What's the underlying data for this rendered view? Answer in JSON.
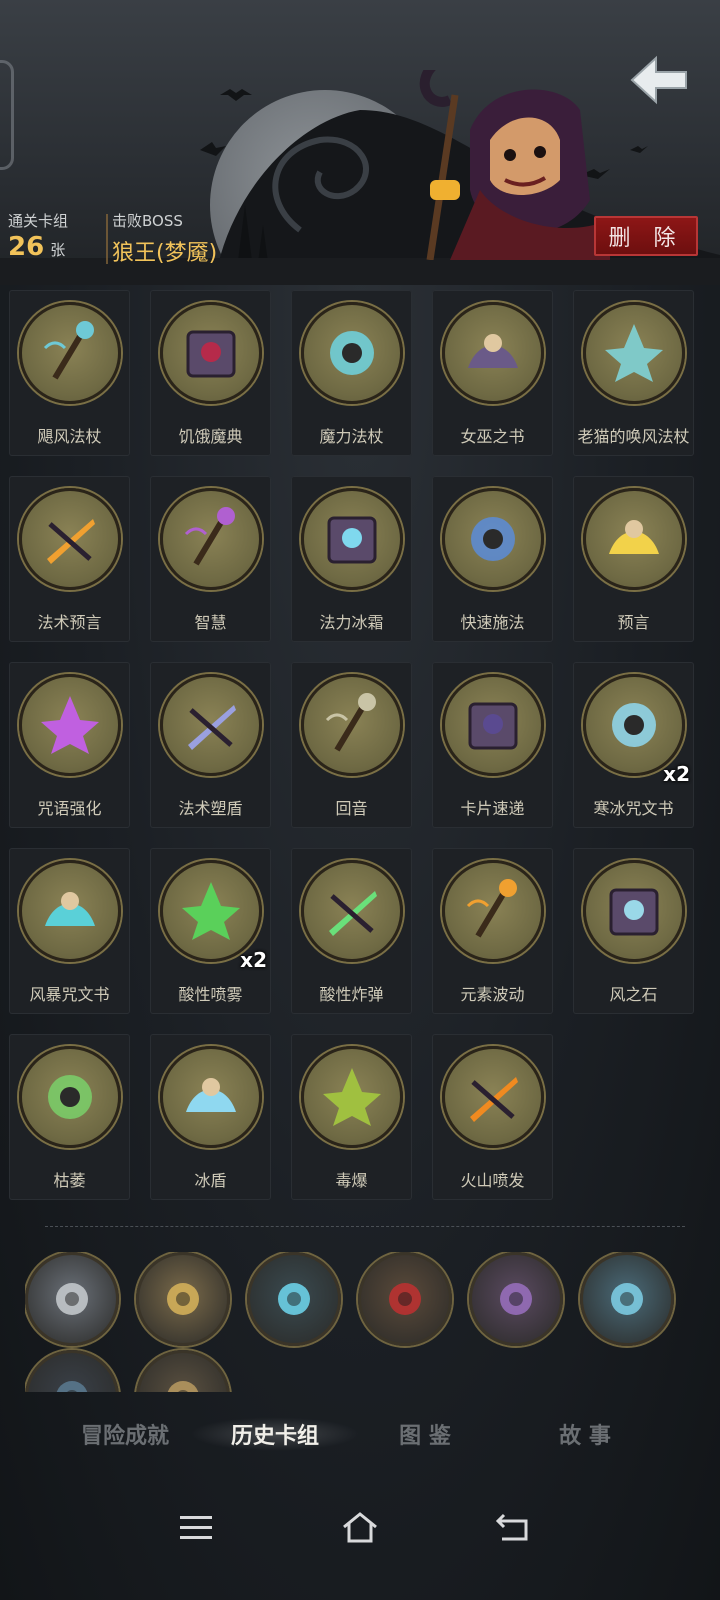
{
  "header": {
    "cleared_deck_label": "通关卡组",
    "card_count": "26",
    "card_unit": "张",
    "boss_label": "击败BOSS",
    "boss_name": "狼王(梦魇)",
    "delete_label": "删 除"
  },
  "cards": [
    {
      "name": "飓风法杖",
      "icon": "wind-staff-icon",
      "accent": "#6ec9d6"
    },
    {
      "name": "饥饿魔典",
      "icon": "hungry-grimoire-icon",
      "accent": "#b62a4a"
    },
    {
      "name": "魔力法杖",
      "icon": "mana-staff-icon",
      "accent": "#6fd4e0"
    },
    {
      "name": "女巫之书",
      "icon": "witch-book-icon",
      "accent": "#6a5a88"
    },
    {
      "name": "老猫的唤风法杖",
      "icon": "old-cat-wind-staff-icon",
      "accent": "#7fc9c8"
    },
    {
      "name": "法术预言",
      "icon": "spell-prophecy-icon",
      "accent": "#f0a030"
    },
    {
      "name": "智慧",
      "icon": "wisdom-icon",
      "accent": "#b060d0"
    },
    {
      "name": "法力冰霜",
      "icon": "mana-frost-icon",
      "accent": "#7fd8ee"
    },
    {
      "name": "快速施法",
      "icon": "quick-cast-icon",
      "accent": "#5a8cd8"
    },
    {
      "name": "预言",
      "icon": "prophecy-icon",
      "accent": "#f2d24a"
    },
    {
      "name": "咒语强化",
      "icon": "spell-boost-icon",
      "accent": "#c060e0"
    },
    {
      "name": "法术塑盾",
      "icon": "spell-shield-icon",
      "accent": "#9aa0e0"
    },
    {
      "name": "回音",
      "icon": "echo-icon",
      "accent": "#c9c4a6"
    },
    {
      "name": "卡片速递",
      "icon": "card-delivery-icon",
      "accent": "#5a4a90"
    },
    {
      "name": "寒冰咒文书",
      "icon": "frost-spellbook-icon",
      "accent": "#8fd8f0",
      "badge": "x2"
    },
    {
      "name": "风暴咒文书",
      "icon": "storm-spellbook-icon",
      "accent": "#5ad0d8"
    },
    {
      "name": "酸性喷雾",
      "icon": "acid-spray-icon",
      "accent": "#5ad05a",
      "badge": "x2"
    },
    {
      "name": "酸性炸弹",
      "icon": "acid-bomb-icon",
      "accent": "#6ae07a"
    },
    {
      "name": "元素波动",
      "icon": "elemental-wave-icon",
      "accent": "#f0a030"
    },
    {
      "name": "风之石",
      "icon": "wind-stone-icon",
      "accent": "#9ad8e8"
    },
    {
      "name": "枯萎",
      "icon": "wither-icon",
      "accent": "#7ad06a"
    },
    {
      "name": "冰盾",
      "icon": "ice-shield-icon",
      "accent": "#8fd8f0"
    },
    {
      "name": "毒爆",
      "icon": "poison-burst-icon",
      "accent": "#a0c040"
    },
    {
      "name": "火山喷发",
      "icon": "volcano-icon",
      "accent": "#f08a20"
    }
  ],
  "relics": [
    {
      "icon": "mirror-relic-icon",
      "accent": "#c8cdd0"
    },
    {
      "icon": "hourglass-relic-icon",
      "accent": "#d8b45a"
    },
    {
      "icon": "campfire-relic-icon",
      "accent": "#6fd8f0"
    },
    {
      "icon": "brute-relic-icon",
      "accent": "#c03030"
    },
    {
      "icon": "goblin-relic-icon",
      "accent": "#9a70c0"
    },
    {
      "icon": "ice-crystal-relic-icon",
      "accent": "#7fd0e8"
    },
    {
      "icon": "serpent-relic-icon",
      "accent": "#5a7a90"
    },
    {
      "icon": "hooded-figure-relic-icon",
      "accent": "#b89a60"
    }
  ],
  "tabs": [
    {
      "label": "冒险成就",
      "active": false
    },
    {
      "label": "历史卡组",
      "active": true
    },
    {
      "label": "图  鉴",
      "active": false
    },
    {
      "label": "故  事",
      "active": false
    }
  ],
  "nav": {
    "menu_icon": "menu-icon",
    "home_icon": "home-icon",
    "back_icon": "system-back-icon"
  }
}
